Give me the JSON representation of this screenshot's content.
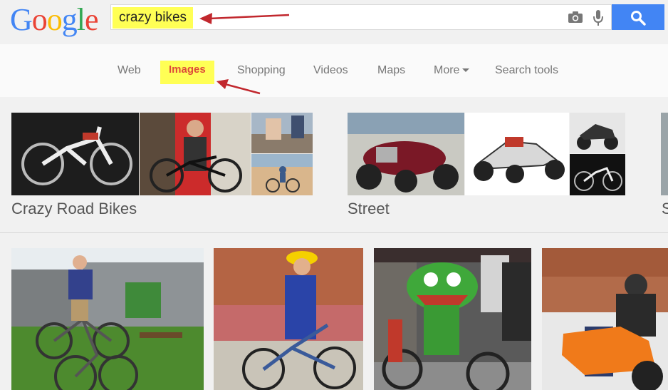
{
  "header": {
    "logo_text": "Google",
    "search_query": "crazy bikes",
    "accent_color": "#4285f4",
    "icons": [
      "camera-icon",
      "microphone-icon",
      "search-icon"
    ]
  },
  "nav": {
    "tabs": [
      {
        "label": "Web"
      },
      {
        "label": "Images",
        "active": true
      },
      {
        "label": "Shopping"
      },
      {
        "label": "Videos"
      },
      {
        "label": "Maps"
      },
      {
        "label": "More"
      },
      {
        "label": "Search tools"
      }
    ]
  },
  "clusters": [
    {
      "title": "Crazy Road Bikes"
    },
    {
      "title": "Street"
    },
    {
      "title": "S"
    }
  ],
  "annotations": {
    "highlight_color": "#ffff55",
    "arrow_color": "#c1272d"
  }
}
